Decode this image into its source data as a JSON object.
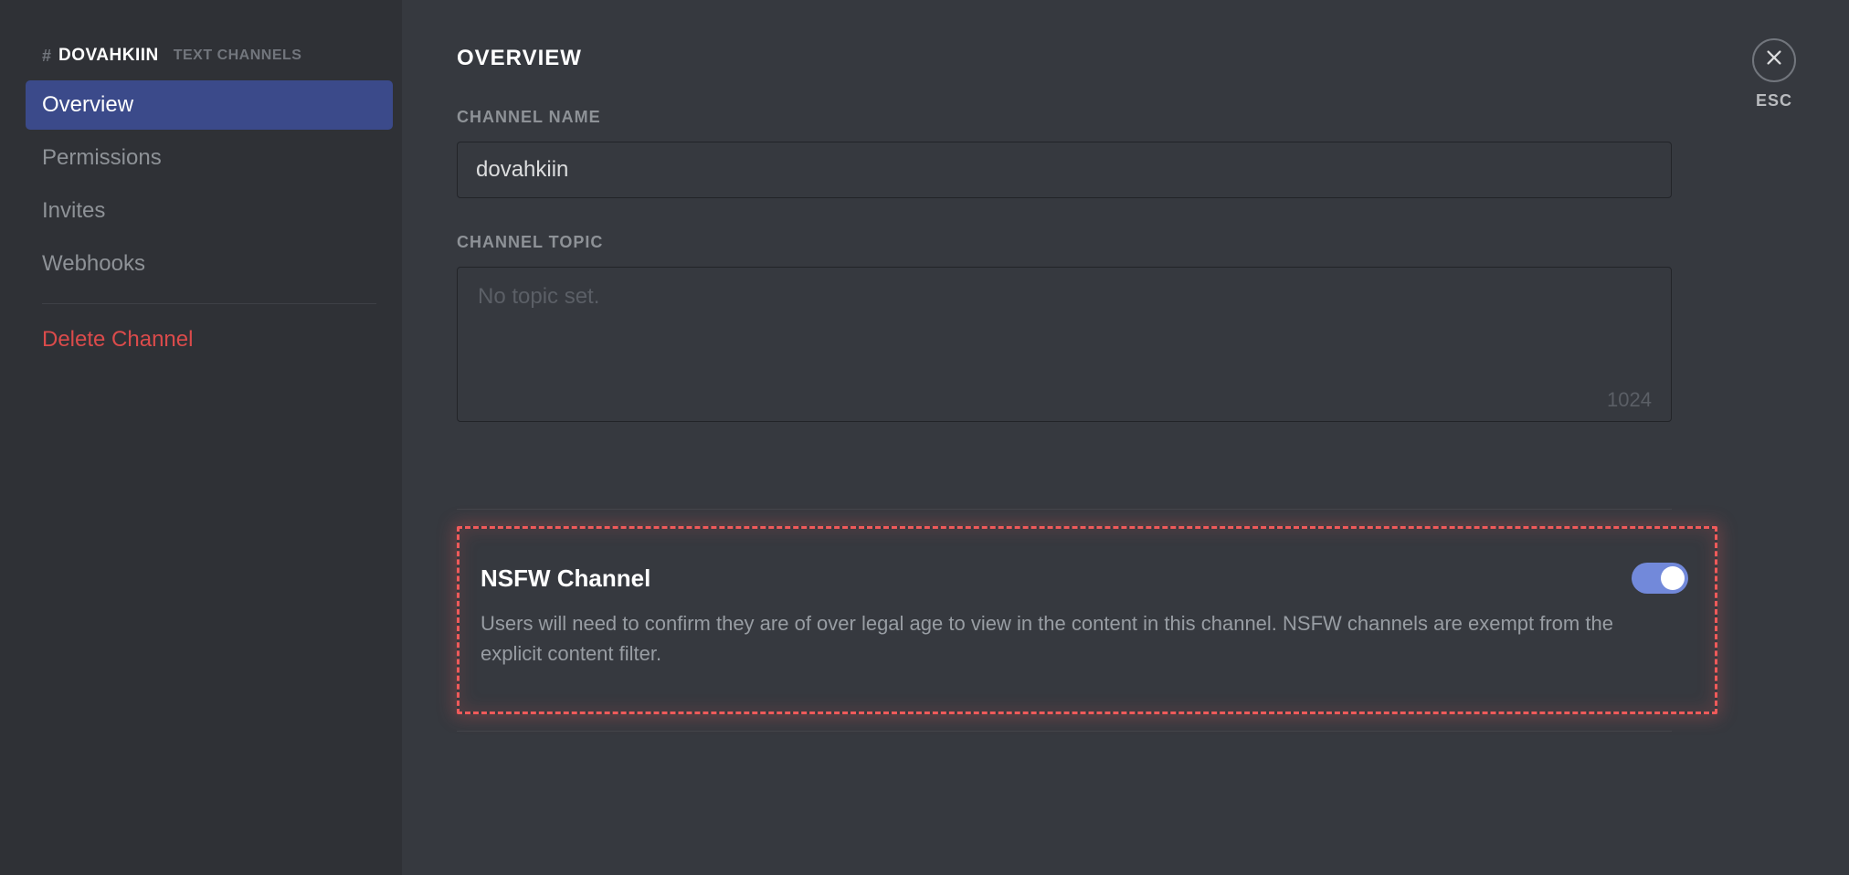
{
  "sidebar": {
    "hash_icon": "#",
    "channel_name_upper": "DOVAHKIIN",
    "header_sub": "TEXT CHANNELS",
    "items": [
      {
        "label": "Overview",
        "active": true
      },
      {
        "label": "Permissions",
        "active": false
      },
      {
        "label": "Invites",
        "active": false
      },
      {
        "label": "Webhooks",
        "active": false
      }
    ],
    "delete_label": "Delete Channel"
  },
  "close": {
    "label": "ESC"
  },
  "overview": {
    "title": "OVERVIEW",
    "channel_name_label": "CHANNEL NAME",
    "channel_name_value": "dovahkiin",
    "channel_topic_label": "CHANNEL TOPIC",
    "channel_topic_placeholder": "No topic set.",
    "channel_topic_value": "",
    "topic_char_remaining": "1024",
    "nsfw": {
      "title": "NSFW Channel",
      "description": "Users will need to confirm they are of over legal age to view in the content in this channel. NSFW channels are exempt from the explicit content filter.",
      "enabled": true
    }
  }
}
